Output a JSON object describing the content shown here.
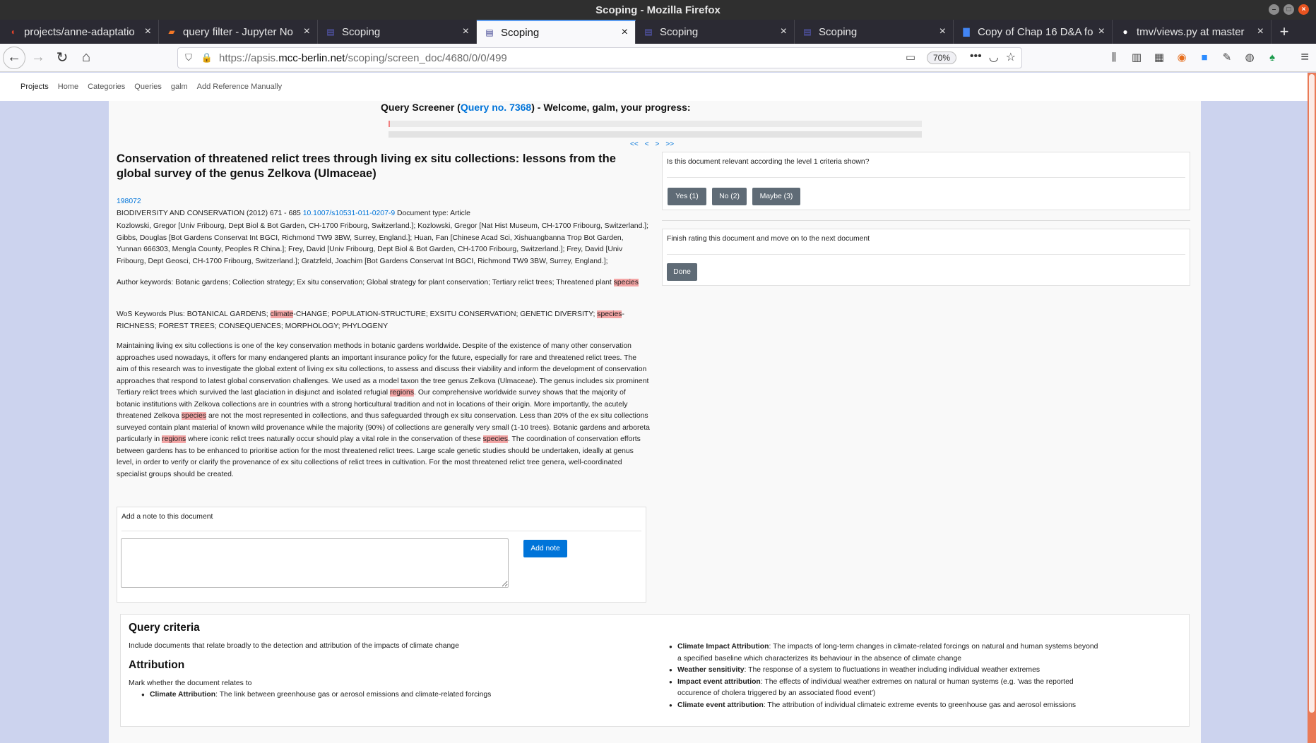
{
  "window": {
    "title": "Scoping - Mozilla Firefox"
  },
  "tabs": [
    {
      "label": "projects/anne-adaptatio",
      "icon": "gitlab-icon"
    },
    {
      "label": "query filter - Jupyter No",
      "icon": "jupyter-icon"
    },
    {
      "label": "Scoping",
      "icon": "document-icon"
    },
    {
      "label": "Scoping",
      "icon": "document-icon",
      "active": true
    },
    {
      "label": "Scoping",
      "icon": "document-icon"
    },
    {
      "label": "Scoping",
      "icon": "document-icon"
    },
    {
      "label": "Copy of Chap 16 D&A fo",
      "icon": "google-docs-icon"
    },
    {
      "label": "tmv/views.py at master",
      "icon": "github-icon"
    }
  ],
  "address": {
    "prefix": "https://apsis.",
    "domain": "mcc-berlin.net",
    "path": "/scoping/screen_doc/4680/0/0/499",
    "zoom": "70%"
  },
  "site_nav": [
    "Projects",
    "Home",
    "Categories",
    "Queries",
    "galm",
    "Add Reference Manually"
  ],
  "screener": {
    "prefix": "Query Screener (",
    "query_link": "Query no. 7368",
    "suffix": ") - Welcome, galm, your progress:",
    "progress": 0.003,
    "pager": [
      "<<",
      "<",
      ">",
      ">>"
    ]
  },
  "document": {
    "title": "Conservation of threatened relict trees through living ex situ collections: lessons from the global survey of the genus Zelkova (Ulmaceae)",
    "id": "198072",
    "source": "BIODIVERSITY AND CONSERVATION (2012) 671 - 685",
    "doi": "10.1007/s10531-011-0207-9",
    "doc_type": "Document type: Article",
    "authors": "Kozlowski, Gregor [Univ Fribourg, Dept Biol & Bot Garden, CH-1700 Fribourg, Switzerland.]; Kozlowski, Gregor [Nat Hist Museum, CH-1700 Fribourg, Switzerland.]; Gibbs, Douglas [Bot Gardens Conservat Int BGCI, Richmond TW9 3BW, Surrey, England.]; Huan, Fan [Chinese Acad Sci, Xishuangbanna Trop Bot Garden, Yunnan 666303, Mengla County, Peoples R China.]; Frey, David [Univ Fribourg, Dept Biol & Bot Garden, CH-1700 Fribourg, Switzerland.]; Frey, David [Univ Fribourg, Dept Geosci, CH-1700 Fribourg, Switzerland.]; Gratzfeld, Joachim [Bot Gardens Conservat Int BGCI, Richmond TW9 3BW, Surrey, England.];",
    "author_keywords": [
      "Author keywords: Botanic gardens; Collection strategy; Ex situ conservation; Global strategy for plant conservation; Tertiary relict trees; Threatened plant ",
      "species",
      ""
    ],
    "wos_keywords": [
      "WoS Keywords Plus: BOTANICAL GARDENS; ",
      "climate",
      "-CHANGE; POPULATION-STRUCTURE; EXSITU CONSERVATION; GENETIC DIVERSITY; ",
      "species",
      "-RICHNESS; FOREST TREES; CONSEQUENCES; MORPHOLOGY; PHYLOGENY"
    ],
    "abstract": [
      "Maintaining living ex situ collections is one of the key conservation methods in botanic gardens worldwide. Despite of the existence of many other conservation approaches used nowadays, it offers for many endangered plants an important insurance policy for the future, especially for rare and threatened relict trees. The aim of this research was to investigate the global extent of living ex situ collections, to assess and discuss their viability and inform the development of conservation approaches that respond to latest global conservation challenges. We used as a model taxon the tree genus Zelkova (Ulmaceae). The genus includes six prominent Tertiary relict trees which survived the last glaciation in disjunct and isolated refugial ",
      "regions",
      ". Our comprehensive worldwide survey shows that the majority of botanic institutions with Zelkova collections are in countries with a strong horticultural tradition and not in locations of their origin. More importantly, the acutely threatened Zelkova ",
      "species",
      " are not the most represented in collections, and thus safeguarded through ex situ conservation. Less than 20% of the ex situ collections surveyed contain plant material of known wild provenance while the majority (90%) of collections are generally very small (1-10 trees). Botanic gardens and arboreta particularly in ",
      "regions",
      " where iconic relict trees naturally occur should play a vital role in the conservation of these ",
      "species",
      ". The coordination of conservation efforts between gardens has to be enhanced to prioritise action for the most threatened relict trees. Large scale genetic studies should be undertaken, ideally at genus level, in order to verify or clarify the provenance of ex situ collections of relict trees in cultivation. For the most threatened relict tree genera, well-coordinated specialist groups should be created."
    ]
  },
  "note": {
    "label": "Add a note to this document",
    "button": "Add note"
  },
  "relevance": {
    "question": "Is this document relevant according the level 1 criteria shown?",
    "yes": "Yes (1)",
    "no": "No (2)",
    "maybe": "Maybe (3)"
  },
  "finish": {
    "text": "Finish rating this document and move on to the next document",
    "button": "Done"
  },
  "criteria": {
    "heading": "Query criteria",
    "description": "Include documents that relate broadly to the detection and attribution of the impacts of climate change",
    "attribution_heading": "Attribution",
    "attribution_intro": "Mark whether the document relates to",
    "left_items": [
      {
        "term": "Climate Attribution",
        "text": ": The link between greenhouse gas or aerosol emissions and climate-related forcings"
      }
    ],
    "right_items": [
      {
        "term": "Climate Impact Attribution",
        "text": ": The impacts of long-term changes in climate-related forcings on natural and human systems beyond a specified baseline which characterizes its behaviour in the absence of climate change"
      },
      {
        "term": "Weather sensitivity",
        "text": ": The response of a system to fluctuations in weather including individual weather extremes"
      },
      {
        "term": "Impact event attribution",
        "text": ": The effects of individual weather extremes on natural or human systems (e.g. 'was the reported occurence of cholera triggered by an associated flood event')"
      },
      {
        "term": "Climate event attribution",
        "text": ": The attribution of individual climateic extreme events to greenhouse gas and aerosol emissions"
      }
    ]
  }
}
